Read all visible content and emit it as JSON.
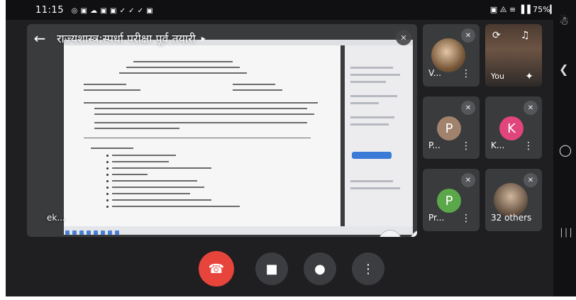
{
  "status_bar": {
    "time": "11:15",
    "left_icons": "◎ ▣ ☁ ▣ ▣ ✓ ✓ ✓ ▣",
    "right_text": "▣ ⨻ ≡ ▐▐ 75%▎"
  },
  "presentation": {
    "title": "राज्यशास्त्र:स्पर्धा परीक्षा पूर्व तयारी",
    "presenter_label": "ek...",
    "back_icon": "←",
    "chevron_icon": "▸",
    "pin_icon": "✕",
    "expand_icon": "⛶",
    "mute_icon": "✕"
  },
  "participants": [
    {
      "name": "V...",
      "type": "photo",
      "muted": true
    },
    {
      "name": "You",
      "type": "video",
      "muted": false
    },
    {
      "name": "P...",
      "initial": "P",
      "color": "#a0826d",
      "muted": true
    },
    {
      "name": "K...",
      "initial": "K",
      "color": "#e0457b",
      "muted": true
    },
    {
      "name": "Pr...",
      "initial": "P",
      "color": "#5aa84a",
      "muted": true
    },
    {
      "name": "32 others",
      "type": "photo",
      "muted": true
    }
  ],
  "controls": {
    "hangup_icon": "☎",
    "camera_icon": "■",
    "mic_icon": "●",
    "more_icon": "⋮"
  },
  "navbar": {
    "accessibility_icon": "☃",
    "back_icon": "❮",
    "home_icon": "◯",
    "recents_icon": "│││"
  },
  "colors": {
    "hangup": "#e7443b",
    "background": "#1f1f21",
    "tile": "#3a3b3d"
  }
}
